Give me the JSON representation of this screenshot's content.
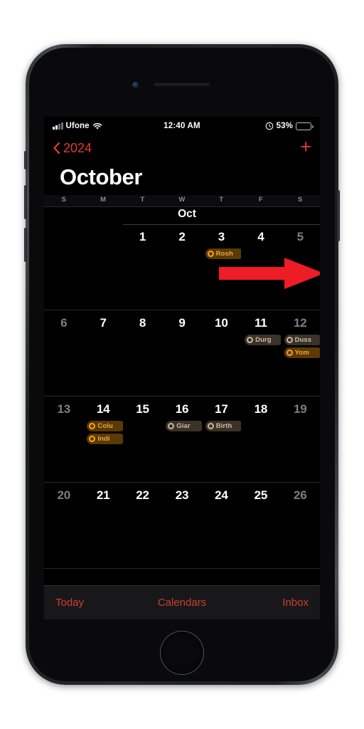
{
  "device": {
    "type": "iphone-with-home-button",
    "frame_color": "#2b2d31"
  },
  "status_bar": {
    "carrier": "Ufone",
    "signal_icon": "cellular-signal-icon",
    "wifi_icon": "wifi-icon",
    "time": "12:40 AM",
    "alarm_icon": "alarm-clock-icon",
    "battery_percent": "53%",
    "battery_level": 53,
    "battery_icon": "battery-icon"
  },
  "nav_bar": {
    "back_label": "2024",
    "back_icon": "chevron-left-icon",
    "add_label": "+",
    "accent_color": "#e03b2e"
  },
  "header": {
    "month_title": "October",
    "weekdays": [
      "S",
      "M",
      "T",
      "W",
      "T",
      "F",
      "S"
    ],
    "month_strip_label": "Oct"
  },
  "calendar": {
    "weeks": [
      {
        "days": [
          {
            "number": "",
            "empty": true,
            "dim": false,
            "events": []
          },
          {
            "number": "",
            "empty": true,
            "dim": false,
            "events": []
          },
          {
            "number": "1",
            "empty": false,
            "dim": false,
            "events": []
          },
          {
            "number": "2",
            "empty": false,
            "dim": false,
            "events": []
          },
          {
            "number": "3",
            "empty": false,
            "dim": false,
            "events": [
              {
                "title": "Rosh",
                "color": "orange"
              }
            ]
          },
          {
            "number": "4",
            "empty": false,
            "dim": false,
            "events": []
          },
          {
            "number": "5",
            "empty": false,
            "dim": true,
            "events": []
          }
        ]
      },
      {
        "days": [
          {
            "number": "6",
            "empty": false,
            "dim": true,
            "events": []
          },
          {
            "number": "7",
            "empty": false,
            "dim": false,
            "events": []
          },
          {
            "number": "8",
            "empty": false,
            "dim": false,
            "events": []
          },
          {
            "number": "9",
            "empty": false,
            "dim": false,
            "events": []
          },
          {
            "number": "10",
            "empty": false,
            "dim": false,
            "events": []
          },
          {
            "number": "11",
            "empty": false,
            "dim": false,
            "events": [
              {
                "title": "Durg",
                "color": "muted"
              }
            ]
          },
          {
            "number": "12",
            "empty": false,
            "dim": true,
            "events": [
              {
                "title": "Duss",
                "color": "muted"
              },
              {
                "title": "Yom",
                "color": "orange"
              }
            ]
          }
        ]
      },
      {
        "days": [
          {
            "number": "13",
            "empty": false,
            "dim": true,
            "events": []
          },
          {
            "number": "14",
            "empty": false,
            "dim": false,
            "events": [
              {
                "title": "Colu",
                "color": "orange"
              },
              {
                "title": "Indi",
                "color": "orange"
              }
            ]
          },
          {
            "number": "15",
            "empty": false,
            "dim": false,
            "events": []
          },
          {
            "number": "16",
            "empty": false,
            "dim": false,
            "events": [
              {
                "title": "Giar",
                "color": "muted"
              }
            ]
          },
          {
            "number": "17",
            "empty": false,
            "dim": false,
            "events": [
              {
                "title": "Birth",
                "color": "muted"
              }
            ]
          },
          {
            "number": "18",
            "empty": false,
            "dim": false,
            "events": []
          },
          {
            "number": "19",
            "empty": false,
            "dim": true,
            "events": []
          }
        ]
      },
      {
        "days": [
          {
            "number": "20",
            "empty": false,
            "dim": true,
            "events": []
          },
          {
            "number": "21",
            "empty": false,
            "dim": false,
            "events": []
          },
          {
            "number": "22",
            "empty": false,
            "dim": false,
            "events": []
          },
          {
            "number": "23",
            "empty": false,
            "dim": false,
            "events": []
          },
          {
            "number": "24",
            "empty": false,
            "dim": false,
            "events": []
          },
          {
            "number": "25",
            "empty": false,
            "dim": false,
            "events": []
          },
          {
            "number": "26",
            "empty": false,
            "dim": true,
            "events": []
          }
        ]
      }
    ]
  },
  "toolbar": {
    "today_label": "Today",
    "calendars_label": "Calendars",
    "inbox_label": "Inbox",
    "accent_color": "#d03c30"
  },
  "annotation": {
    "arrow_icon": "right-arrow-annotation",
    "arrow_color": "#ee1c25",
    "points_to": "add-event-button"
  }
}
